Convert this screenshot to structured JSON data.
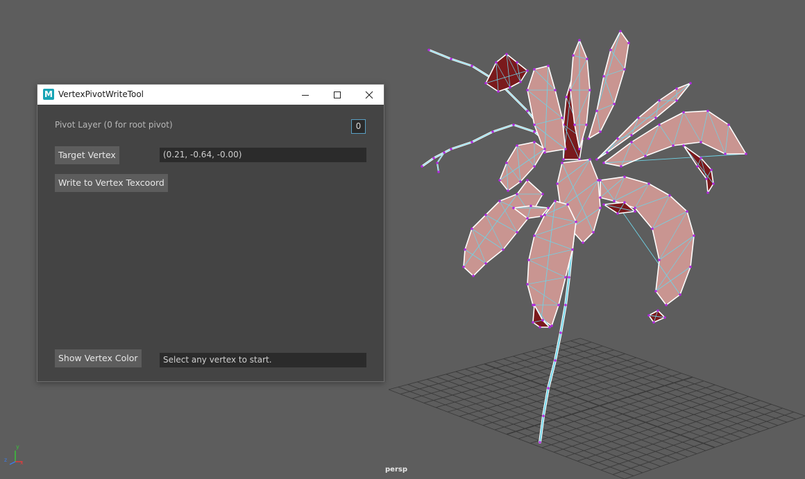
{
  "viewport": {
    "camera_label": "persp",
    "axis_labels": {
      "x": "x",
      "y": "y",
      "z": "z"
    },
    "colors": {
      "background": "#5d5d5d",
      "grid": "#3a3a3a",
      "mesh_fill": "#c99591",
      "mesh_dark_fill": "#7a1a1c",
      "wire": "#6fd3e6",
      "border_edge": "#ffffff",
      "vertex": "#b02adf"
    }
  },
  "tool_window": {
    "title": "VertexPivotWriteTool",
    "icon_letter": "M",
    "icon": "maya-app-icon",
    "controls": {
      "minimize": "minimize-icon",
      "maximize": "maximize-icon",
      "close": "close-icon"
    },
    "pivot_layer_label": "Pivot Layer (0 for root pivot)",
    "pivot_layer_value": "0",
    "target_vertex_button": "Target Vertex",
    "target_vertex_value": "(0.21, -0.64, -0.00)",
    "write_button": "Write to Vertex Texcoord",
    "show_color_button": "Show Vertex Color",
    "status_text": "Select any vertex to start."
  }
}
